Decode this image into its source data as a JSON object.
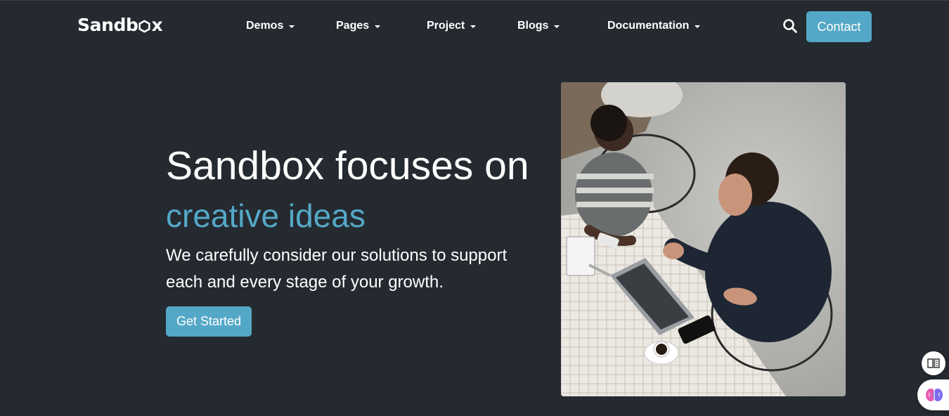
{
  "header": {
    "logo": {
      "text_before": "Sandb",
      "text_after": "x"
    },
    "nav": [
      {
        "label": "Demos"
      },
      {
        "label": "Pages"
      },
      {
        "label": "Project"
      },
      {
        "label": "Blogs"
      },
      {
        "label": "Documentation"
      }
    ],
    "search_icon": "search-icon",
    "contact_label": "Contact"
  },
  "hero": {
    "title_line1": "Sandbox focuses on",
    "title_line2": "creative ideas",
    "description": "We carefully consider our solutions to support each and every stage of your growth.",
    "cta_label": "Get Started"
  },
  "widgets": {
    "reader_icon": "book-open-icon",
    "assistant_icon": "brain-icon"
  },
  "colors": {
    "background": "#252a31",
    "accent": "#54a8c7",
    "text": "#ffffff"
  }
}
